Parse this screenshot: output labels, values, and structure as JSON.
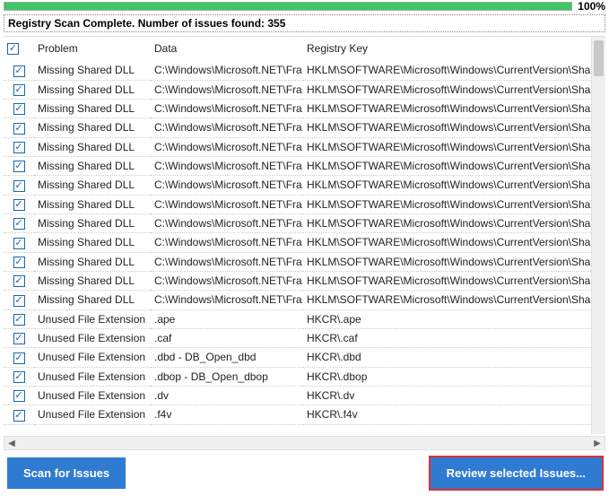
{
  "progress": {
    "percent_label": "100%"
  },
  "status": "Registry Scan Complete. Number of issues found: 355",
  "columns": {
    "problem": "Problem",
    "data": "Data",
    "key": "Registry Key"
  },
  "rows": [
    {
      "checked": true,
      "problem": "Missing Shared DLL",
      "data": "C:\\Windows\\Microsoft.NET\\Fra...",
      "key": "HKLM\\SOFTWARE\\Microsoft\\Windows\\CurrentVersion\\SharedDlls"
    },
    {
      "checked": true,
      "problem": "Missing Shared DLL",
      "data": "C:\\Windows\\Microsoft.NET\\Fra...",
      "key": "HKLM\\SOFTWARE\\Microsoft\\Windows\\CurrentVersion\\SharedDlls"
    },
    {
      "checked": true,
      "problem": "Missing Shared DLL",
      "data": "C:\\Windows\\Microsoft.NET\\Fra...",
      "key": "HKLM\\SOFTWARE\\Microsoft\\Windows\\CurrentVersion\\SharedDlls"
    },
    {
      "checked": true,
      "problem": "Missing Shared DLL",
      "data": "C:\\Windows\\Microsoft.NET\\Fra...",
      "key": "HKLM\\SOFTWARE\\Microsoft\\Windows\\CurrentVersion\\SharedDlls"
    },
    {
      "checked": true,
      "problem": "Missing Shared DLL",
      "data": "C:\\Windows\\Microsoft.NET\\Fra...",
      "key": "HKLM\\SOFTWARE\\Microsoft\\Windows\\CurrentVersion\\SharedDlls"
    },
    {
      "checked": true,
      "problem": "Missing Shared DLL",
      "data": "C:\\Windows\\Microsoft.NET\\Fra...",
      "key": "HKLM\\SOFTWARE\\Microsoft\\Windows\\CurrentVersion\\SharedDlls"
    },
    {
      "checked": true,
      "problem": "Missing Shared DLL",
      "data": "C:\\Windows\\Microsoft.NET\\Fra...",
      "key": "HKLM\\SOFTWARE\\Microsoft\\Windows\\CurrentVersion\\SharedDlls"
    },
    {
      "checked": true,
      "problem": "Missing Shared DLL",
      "data": "C:\\Windows\\Microsoft.NET\\Fra...",
      "key": "HKLM\\SOFTWARE\\Microsoft\\Windows\\CurrentVersion\\SharedDlls"
    },
    {
      "checked": true,
      "problem": "Missing Shared DLL",
      "data": "C:\\Windows\\Microsoft.NET\\Fra...",
      "key": "HKLM\\SOFTWARE\\Microsoft\\Windows\\CurrentVersion\\SharedDlls"
    },
    {
      "checked": true,
      "problem": "Missing Shared DLL",
      "data": "C:\\Windows\\Microsoft.NET\\Fra...",
      "key": "HKLM\\SOFTWARE\\Microsoft\\Windows\\CurrentVersion\\SharedDlls"
    },
    {
      "checked": true,
      "problem": "Missing Shared DLL",
      "data": "C:\\Windows\\Microsoft.NET\\Fra...",
      "key": "HKLM\\SOFTWARE\\Microsoft\\Windows\\CurrentVersion\\SharedDlls"
    },
    {
      "checked": true,
      "problem": "Missing Shared DLL",
      "data": "C:\\Windows\\Microsoft.NET\\Fra...",
      "key": "HKLM\\SOFTWARE\\Microsoft\\Windows\\CurrentVersion\\SharedDlls"
    },
    {
      "checked": true,
      "problem": "Missing Shared DLL",
      "data": "C:\\Windows\\Microsoft.NET\\Fra...",
      "key": "HKLM\\SOFTWARE\\Microsoft\\Windows\\CurrentVersion\\SharedDlls"
    },
    {
      "checked": true,
      "problem": "Unused File Extension",
      "data": ".ape",
      "key": "HKCR\\.ape"
    },
    {
      "checked": true,
      "problem": "Unused File Extension",
      "data": ".caf",
      "key": "HKCR\\.caf"
    },
    {
      "checked": true,
      "problem": "Unused File Extension",
      "data": ".dbd - DB_Open_dbd",
      "key": "HKCR\\.dbd"
    },
    {
      "checked": true,
      "problem": "Unused File Extension",
      "data": ".dbop - DB_Open_dbop",
      "key": "HKCR\\.dbop"
    },
    {
      "checked": true,
      "problem": "Unused File Extension",
      "data": ".dv",
      "key": "HKCR\\.dv"
    },
    {
      "checked": true,
      "problem": "Unused File Extension",
      "data": ".f4v",
      "key": "HKCR\\.f4v"
    }
  ],
  "buttons": {
    "scan": "Scan for Issues",
    "review": "Review selected Issues..."
  }
}
